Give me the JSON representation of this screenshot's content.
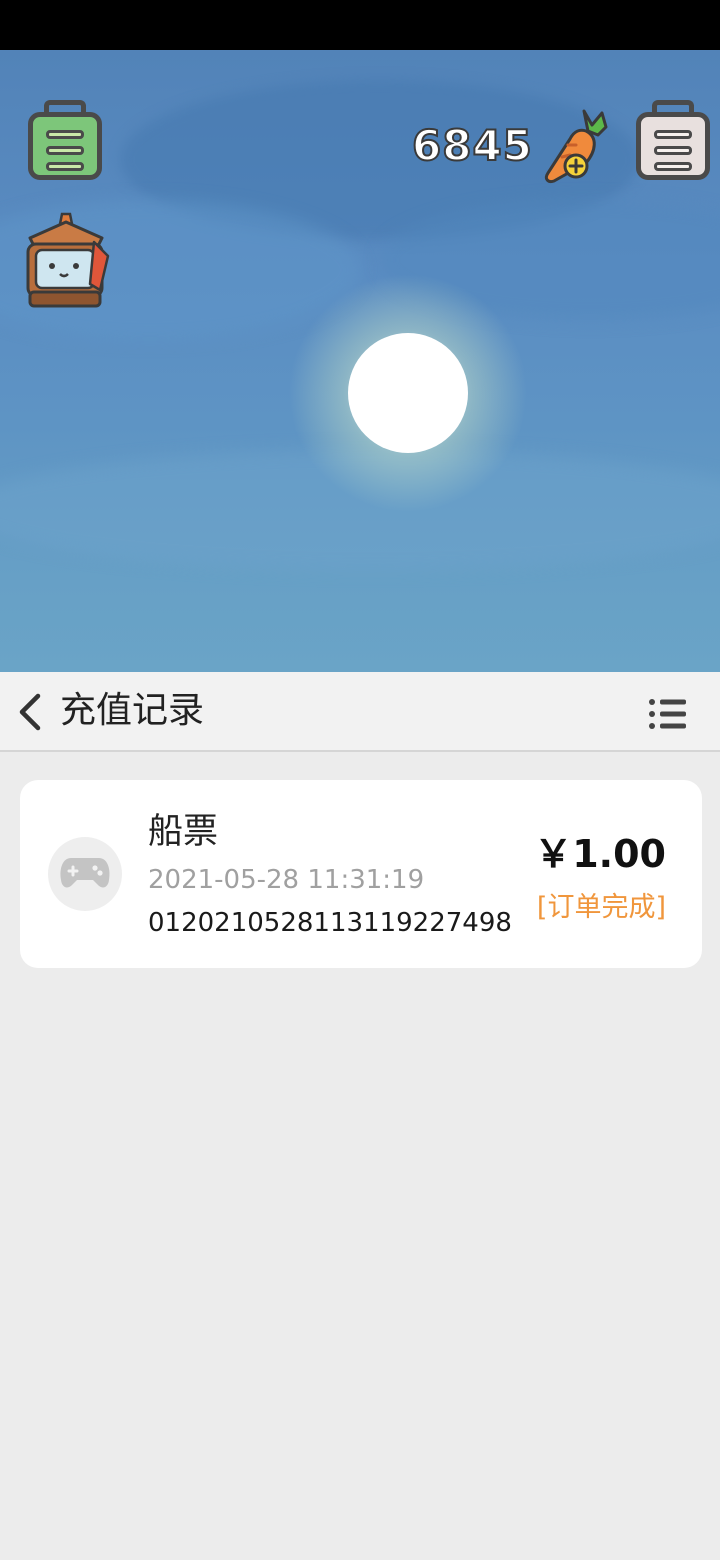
{
  "game": {
    "coin_count": "6845",
    "icons": {
      "left_badge": "green-list-badge-icon",
      "right_badge": "white-list-badge-icon",
      "currency": "carrot-plus-icon",
      "shrine": "shrine-character-icon",
      "moon": "moon"
    }
  },
  "nav": {
    "title": "充值记录",
    "back_icon": "chevron-left-icon",
    "menu_icon": "list-menu-icon"
  },
  "records": [
    {
      "icon": "gamepad-icon",
      "name": "船票",
      "time": "2021-05-28 11:31:19",
      "order_id": "012021052811311922749​8",
      "amount": "￥1.00",
      "status": "[订单完成]"
    }
  ],
  "colors": {
    "status_accent": "#f0963c",
    "panel_bg": "#ececec",
    "sky": "#5a8cc2"
  }
}
